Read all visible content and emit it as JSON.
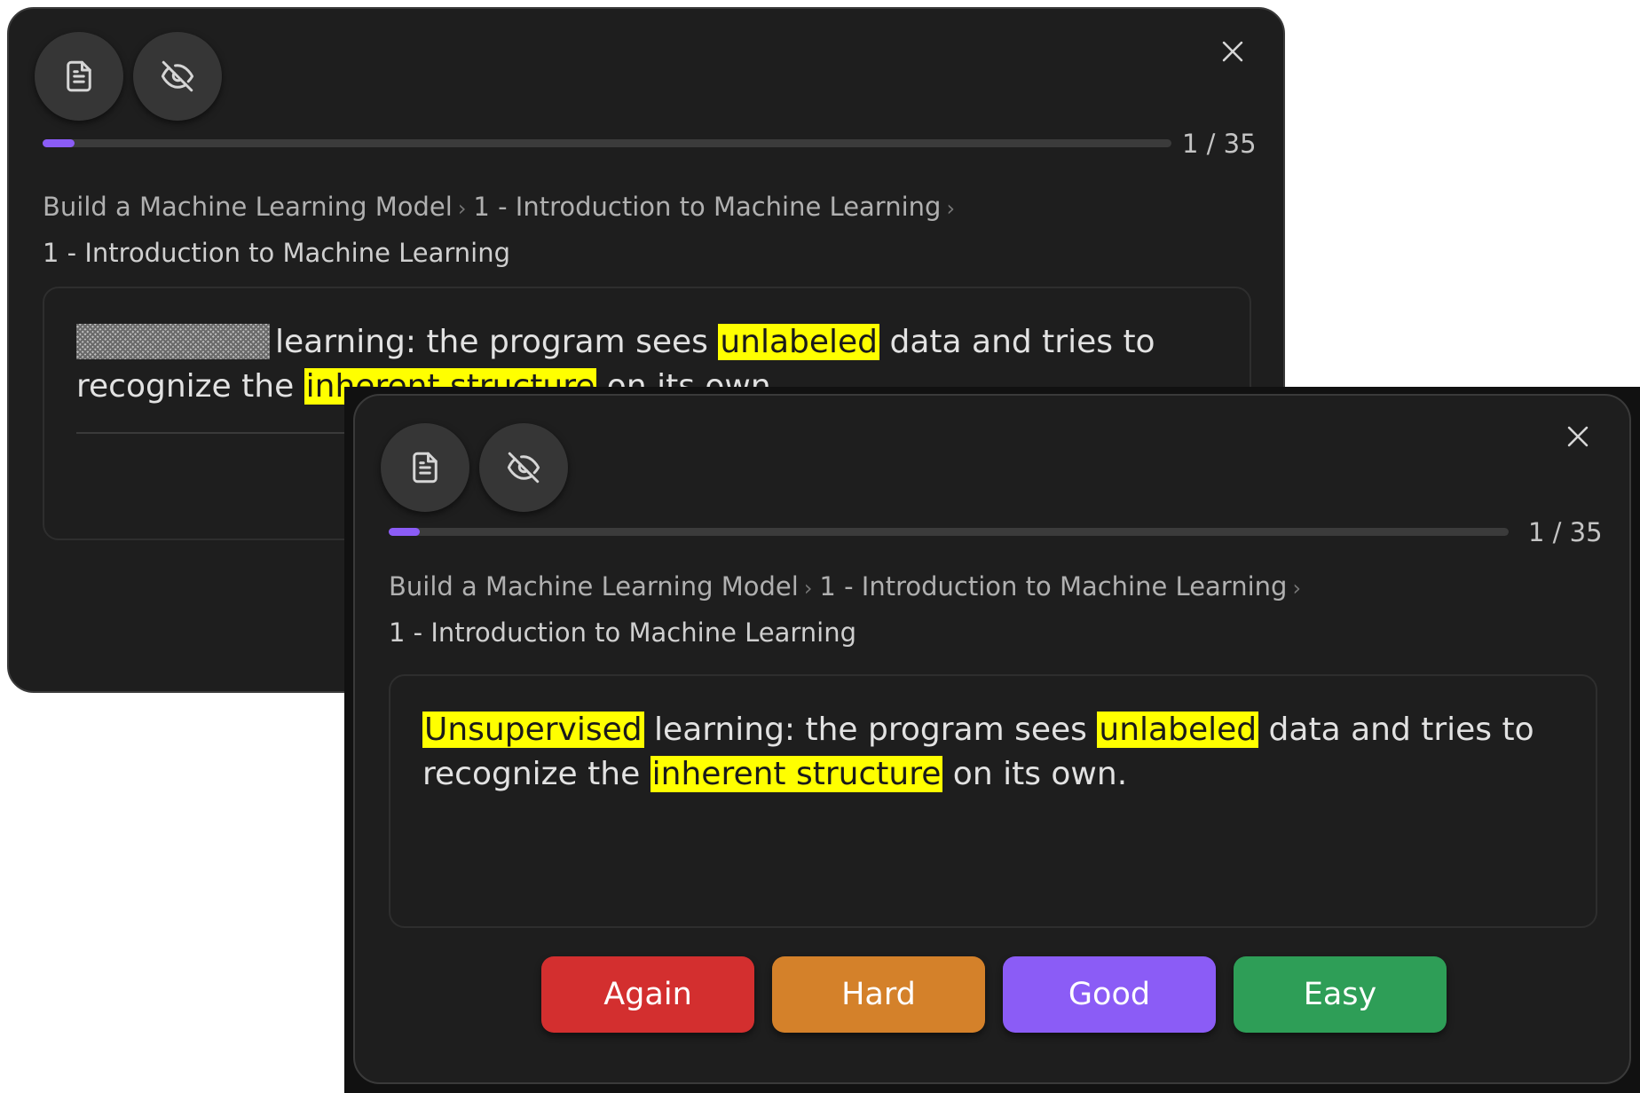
{
  "colors": {
    "background": "#1e1e1e",
    "accent": "#8b5cf6",
    "highlight": "#ffff00",
    "again": "#d32f2f",
    "hard": "#d4812a",
    "good": "#8b5cf6",
    "easy": "#2e9e57"
  },
  "toolbar": {
    "notes_icon": "document-icon",
    "hide_icon": "eye-off-icon",
    "close_icon": "close-icon"
  },
  "progress": {
    "current": 1,
    "total": 35,
    "fraction": 0.028,
    "label": "1 / 35"
  },
  "breadcrumb": {
    "items": [
      "Build a Machine Learning Model",
      "1 - Introduction to Machine Learning",
      "1 - Introduction to Machine Learning"
    ],
    "separator": "›"
  },
  "card_front": {
    "segments": [
      {
        "text": "learning: the program sees ",
        "highlight": false
      },
      {
        "text": "unlabeled",
        "highlight": true
      },
      {
        "text": " data and tries to recognize the ",
        "highlight": false
      },
      {
        "text": "inherent structure",
        "highlight": true
      },
      {
        "text": " on its own.",
        "highlight": false
      }
    ]
  },
  "card_back": {
    "segments": [
      {
        "text": "Unsupervised",
        "highlight": true
      },
      {
        "text": " learning: the program sees ",
        "highlight": false
      },
      {
        "text": "unlabeled",
        "highlight": true
      },
      {
        "text": " data and tries to recognize the ",
        "highlight": false
      },
      {
        "text": "inherent structure",
        "highlight": true
      },
      {
        "text": " on its own.",
        "highlight": false
      }
    ]
  },
  "grades": [
    {
      "label": "Again",
      "color": "#d32f2f"
    },
    {
      "label": "Hard",
      "color": "#d4812a"
    },
    {
      "label": "Good",
      "color": "#8b5cf6"
    },
    {
      "label": "Easy",
      "color": "#2e9e57"
    }
  ]
}
